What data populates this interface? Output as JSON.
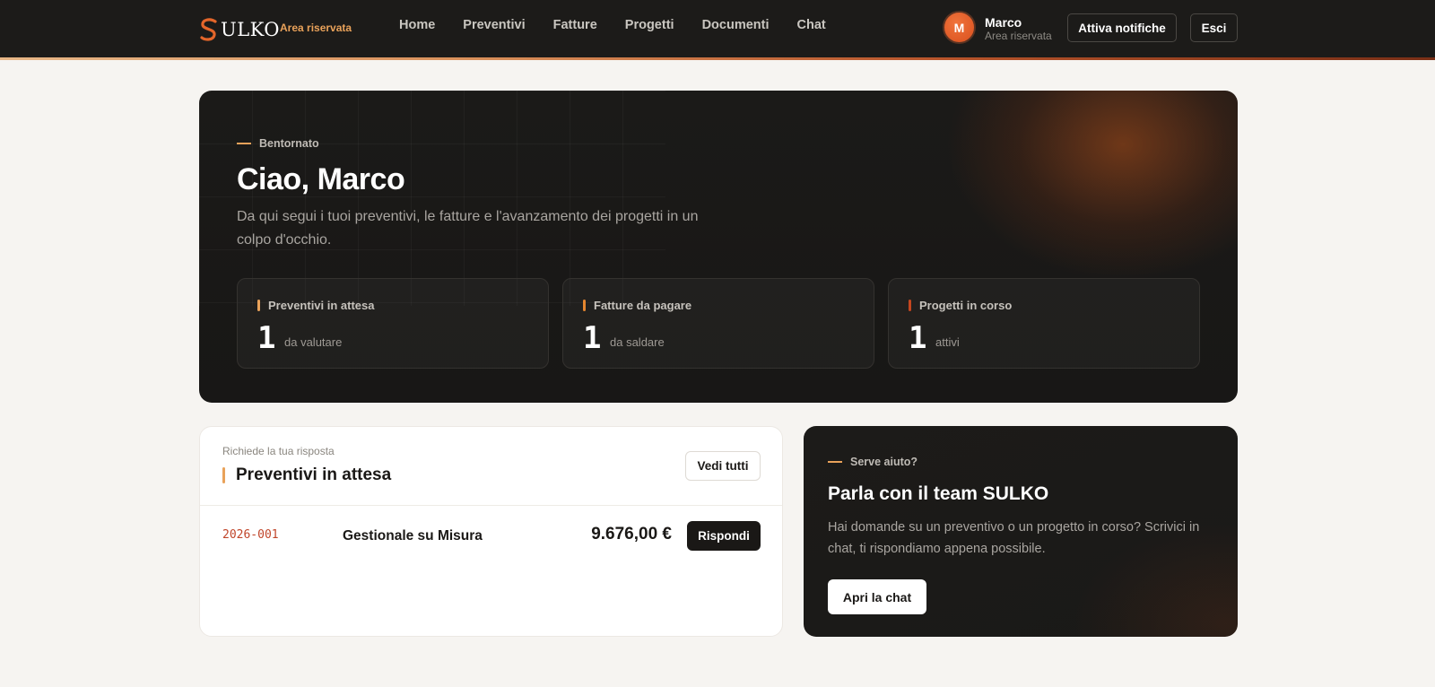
{
  "brand": {
    "logo_text": "ULKO",
    "area_tag": "Area riservata",
    "accent": "#e9a25a",
    "accent_strong": "#e4662a"
  },
  "nav": {
    "items": [
      {
        "label": "Home"
      },
      {
        "label": "Preventivi"
      },
      {
        "label": "Fatture"
      },
      {
        "label": "Progetti"
      },
      {
        "label": "Documenti"
      },
      {
        "label": "Chat"
      }
    ]
  },
  "user": {
    "initial": "M",
    "name": "Marco",
    "subtitle": "Area riservata"
  },
  "header_actions": {
    "notifications_label": "Attiva notifiche",
    "logout_label": "Esci"
  },
  "hero": {
    "eyebrow": "Bentornato",
    "title": "Ciao, Marco",
    "description": "Da qui segui i tuoi preventivi, le fatture e l'avanzamento dei progetti in un colpo d'occhio.",
    "stats": [
      {
        "label": "Preventivi in attesa",
        "value": "1",
        "sub": "da valutare",
        "color": "#e9a25a"
      },
      {
        "label": "Fatture da pagare",
        "value": "1",
        "sub": "da saldare",
        "color": "#e4862f"
      },
      {
        "label": "Progetti in corso",
        "value": "1",
        "sub": "attivi",
        "color": "#c4461f"
      }
    ]
  },
  "quotes_panel": {
    "eyebrow": "Richiede la tua risposta",
    "title": "Preventivi in attesa",
    "see_all_label": "Vedi tutti",
    "rows": [
      {
        "code": "2026-001",
        "name": "Gestionale su Misura",
        "amount": "9.676,00 €",
        "action_label": "Rispondi"
      }
    ]
  },
  "help_panel": {
    "eyebrow": "Serve aiuto?",
    "title": "Parla con il team SULKO",
    "description": "Hai domande su un preventivo o un progetto in corso? Scrivici in chat, ti rispondiamo appena possibile.",
    "button_label": "Apri la chat"
  }
}
